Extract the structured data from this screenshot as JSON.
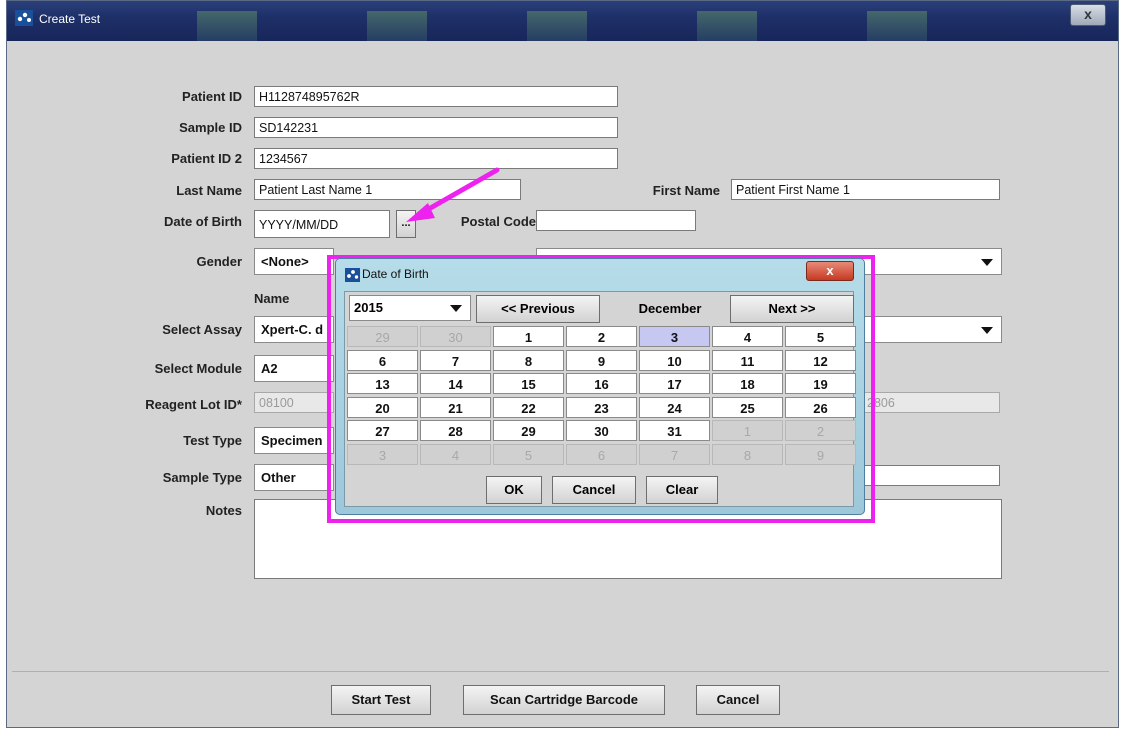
{
  "window": {
    "title": "Create Test",
    "close_label": "x"
  },
  "form": {
    "patient_id": {
      "label": "Patient ID",
      "value": "H112874895762R"
    },
    "sample_id": {
      "label": "Sample ID",
      "value": "SD142231"
    },
    "patient_id2": {
      "label": "Patient ID 2",
      "value": "1234567"
    },
    "last_name": {
      "label": "Last Name",
      "value": "Patient Last Name 1"
    },
    "first_name": {
      "label": "First Name",
      "value": "Patient First Name 1"
    },
    "dob": {
      "label": "Date of Birth",
      "value": "YYYY/MM/DD",
      "picker_label": "..."
    },
    "postal_code": {
      "label": "Postal Code",
      "value": ""
    },
    "gender": {
      "label": "Gender",
      "value": "<None>"
    },
    "name_header": "Name",
    "select_assay": {
      "label": "Select Assay",
      "value": "Xpert-C. d"
    },
    "select_module": {
      "label": "Select Module",
      "value": "A2"
    },
    "reagent_lot": {
      "label": "Reagent Lot ID*",
      "value": "08100",
      "value_right": "2806"
    },
    "test_type": {
      "label": "Test Type",
      "value": "Specimen"
    },
    "sample_type": {
      "label": "Sample Type",
      "value": "Other"
    },
    "notes": {
      "label": "Notes",
      "value": ""
    }
  },
  "buttons": {
    "start": "Start Test",
    "scan": "Scan Cartridge Barcode",
    "cancel": "Cancel"
  },
  "dialog": {
    "title": "Date of Birth",
    "close_label": "x",
    "year": "2015",
    "prev": "<< Previous",
    "month": "December",
    "next": "Next >>",
    "selected_day": "3",
    "weeks": [
      [
        {
          "d": "29",
          "o": true
        },
        {
          "d": "30",
          "o": true
        },
        {
          "d": "1"
        },
        {
          "d": "2"
        },
        {
          "d": "3"
        },
        {
          "d": "4"
        },
        {
          "d": "5"
        }
      ],
      [
        {
          "d": "6"
        },
        {
          "d": "7"
        },
        {
          "d": "8"
        },
        {
          "d": "9"
        },
        {
          "d": "10"
        },
        {
          "d": "11"
        },
        {
          "d": "12"
        }
      ],
      [
        {
          "d": "13"
        },
        {
          "d": "14"
        },
        {
          "d": "15"
        },
        {
          "d": "16"
        },
        {
          "d": "17"
        },
        {
          "d": "18"
        },
        {
          "d": "19"
        }
      ],
      [
        {
          "d": "20"
        },
        {
          "d": "21"
        },
        {
          "d": "22"
        },
        {
          "d": "23"
        },
        {
          "d": "24"
        },
        {
          "d": "25"
        },
        {
          "d": "26"
        }
      ],
      [
        {
          "d": "27"
        },
        {
          "d": "28"
        },
        {
          "d": "29"
        },
        {
          "d": "30"
        },
        {
          "d": "31"
        },
        {
          "d": "1",
          "o": true
        },
        {
          "d": "2",
          "o": true
        }
      ],
      [
        {
          "d": "3",
          "o": true
        },
        {
          "d": "4",
          "o": true
        },
        {
          "d": "5",
          "o": true
        },
        {
          "d": "6",
          "o": true
        },
        {
          "d": "7",
          "o": true
        },
        {
          "d": "8",
          "o": true
        },
        {
          "d": "9",
          "o": true
        }
      ]
    ],
    "ok": "OK",
    "cancel": "Cancel",
    "clear": "Clear"
  },
  "colors": {
    "highlight": "#ee22ee",
    "selected_day": "#c6c8f2",
    "titlebar": "#1f3068"
  }
}
